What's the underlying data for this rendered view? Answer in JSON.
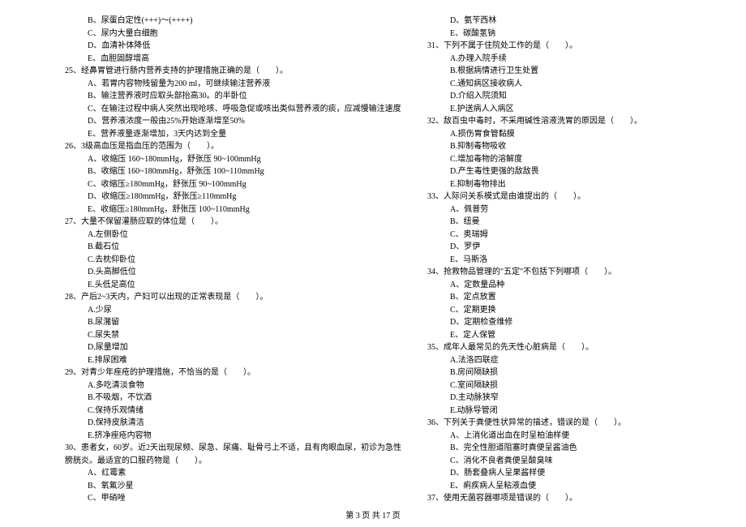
{
  "leftColumn": [
    {
      "type": "option",
      "text": "B、尿蛋白定性(+++)～(++++)"
    },
    {
      "type": "option",
      "text": "C、尿内大量白细胞"
    },
    {
      "type": "option",
      "text": "D、血清补体降低"
    },
    {
      "type": "option",
      "text": "E、血胆固醇增高"
    },
    {
      "type": "question",
      "text": "25、经鼻胃管进行肠内营养支持的护理措施正确的是（　　）。"
    },
    {
      "type": "option",
      "text": "A、若胃内容物残留量为200 ml，可继续输注营养液"
    },
    {
      "type": "option",
      "text": "B、输注营养液时应取头部抬高30。的半卧位"
    },
    {
      "type": "option",
      "text": "C、在输注过程中病人突然出现呛咳、呼吸急促或咳出类似营养液的痰，应减慢输注速度"
    },
    {
      "type": "option",
      "text": "D、营养液浓度一般由25%开始逐渐增至50%"
    },
    {
      "type": "option",
      "text": "E、营养液量逐渐增加，3天内达到全量"
    },
    {
      "type": "question",
      "text": "26、3级高血压是指血压的范围为（　　）。"
    },
    {
      "type": "option",
      "text": "A、收缩压 160~180mmHg，舒张压 90~100mmHg"
    },
    {
      "type": "option",
      "text": "B、收缩压 160~180mmHg，舒张压 100~110mmHg"
    },
    {
      "type": "option",
      "text": "C、收缩压≥180mmHg，舒张压 90~100mmHg"
    },
    {
      "type": "option",
      "text": "D、收缩压≥180mmHg，舒张压≥110mmHg"
    },
    {
      "type": "option",
      "text": "E、收缩压≥180mmHg，舒张压 100~110mmHg"
    },
    {
      "type": "question",
      "text": "27、大量不保留灌肠应取的体位是（　　）。"
    },
    {
      "type": "option",
      "text": "A.左侧卧位"
    },
    {
      "type": "option",
      "text": "B.截石位"
    },
    {
      "type": "option",
      "text": "C.去枕仰卧位"
    },
    {
      "type": "option",
      "text": "D.头高脚低位"
    },
    {
      "type": "option",
      "text": "E.头低足高位"
    },
    {
      "type": "question",
      "text": "28、产后2~3天内，产妇可以出现的正常表现是（　　）。"
    },
    {
      "type": "option",
      "text": "A.少尿"
    },
    {
      "type": "option",
      "text": "B.尿潴留"
    },
    {
      "type": "option",
      "text": "C.尿失禁"
    },
    {
      "type": "option",
      "text": "D.尿量增加"
    },
    {
      "type": "option",
      "text": "E.排尿困难"
    },
    {
      "type": "question",
      "text": "29、对青少年痤疮的护理措施，不恰当的是（　　）。"
    },
    {
      "type": "option",
      "text": "A.多吃清淡食物"
    },
    {
      "type": "option",
      "text": "B.不吸烟，不饮酒"
    },
    {
      "type": "option",
      "text": "C.保持乐观情绪"
    },
    {
      "type": "option",
      "text": "D.保持皮肤清洁"
    },
    {
      "type": "option",
      "text": "E.挤净痤疮内容物"
    },
    {
      "type": "question",
      "text": "30、患者女，60岁。近2天出现尿频、尿急、尿痛、耻骨弓上不适，且有肉眼血尿，初诊为急性"
    },
    {
      "type": "question",
      "text": "膀胱炎。最适宜的口服药物是（　　）。"
    },
    {
      "type": "option",
      "text": "A、红霉素"
    },
    {
      "type": "option",
      "text": "B、氧氟沙星"
    },
    {
      "type": "option",
      "text": "C、甲硝唑"
    }
  ],
  "rightColumn": [
    {
      "type": "option",
      "text": "D、氨苄西林"
    },
    {
      "type": "option",
      "text": "E、碳酸氢钠"
    },
    {
      "type": "question",
      "text": "31、下列不属于住院处工作的是（　　）。"
    },
    {
      "type": "option",
      "text": "A.办理入院手续"
    },
    {
      "type": "option",
      "text": "B.根据病情进行卫生处置"
    },
    {
      "type": "option",
      "text": "C.通知病区接收病人"
    },
    {
      "type": "option",
      "text": "D.介绍入院须知"
    },
    {
      "type": "option",
      "text": "E.护送病人入病区"
    },
    {
      "type": "question",
      "text": "32、敌百虫中毒时，不采用碱性溶液洗胃的原因是（　　）。"
    },
    {
      "type": "option",
      "text": "A.损伤胃食管黏膜"
    },
    {
      "type": "option",
      "text": "B.抑制毒物吸收"
    },
    {
      "type": "option",
      "text": "C.增加毒物的溶解度"
    },
    {
      "type": "option",
      "text": "D.产生毒性更强的敌敌畏"
    },
    {
      "type": "option",
      "text": "E.抑制毒物排出"
    },
    {
      "type": "question",
      "text": "33、人际问关系模式是由谁提出的（　　）。"
    },
    {
      "type": "option",
      "text": "A、佩普劳"
    },
    {
      "type": "option",
      "text": "B、纽曼"
    },
    {
      "type": "option",
      "text": "C、奥瑞姆"
    },
    {
      "type": "option",
      "text": "D、罗伊"
    },
    {
      "type": "option",
      "text": "E、马斯洛"
    },
    {
      "type": "question",
      "text": "34、抢救物品管理的\"五定\"不包括下列哪项（　　）。"
    },
    {
      "type": "option",
      "text": "A、定数量品种"
    },
    {
      "type": "option",
      "text": "B、定点放置"
    },
    {
      "type": "option",
      "text": "C、定期更换"
    },
    {
      "type": "option",
      "text": "D、定期检查维修"
    },
    {
      "type": "option",
      "text": "E、定人保管"
    },
    {
      "type": "question",
      "text": "35、成年人最常见的先天性心脏病是（　　）。"
    },
    {
      "type": "option",
      "text": "A.法洛四联症"
    },
    {
      "type": "option",
      "text": "B.房间隔缺损"
    },
    {
      "type": "option",
      "text": "C.室间隔缺损"
    },
    {
      "type": "option",
      "text": "D.主动脉狭窄"
    },
    {
      "type": "option",
      "text": "E.动脉导管闭"
    },
    {
      "type": "question",
      "text": "36、下列关于粪便性状异常的描述，错误的是（　　）。"
    },
    {
      "type": "option",
      "text": "A、上消化道出血在时呈柏油样便"
    },
    {
      "type": "option",
      "text": "B、完全性胆道阻塞时粪便呈酱油色"
    },
    {
      "type": "option",
      "text": "C、消化不良者粪便呈酸臭味"
    },
    {
      "type": "option",
      "text": "D、肠套叠病人呈果酱样便"
    },
    {
      "type": "option",
      "text": "E、痢疾病人呈粘液血便"
    },
    {
      "type": "question",
      "text": "37、使用无菌容器哪项是错误的（　　）。"
    }
  ],
  "footer": "第 3 页 共 17 页"
}
